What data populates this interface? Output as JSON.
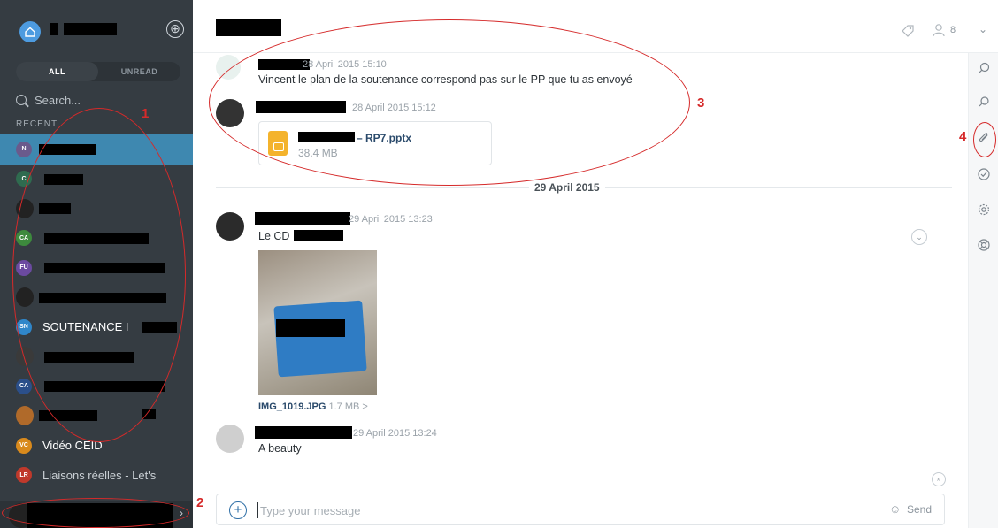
{
  "sidebar": {
    "add_room_symbol": "⊕",
    "filter_tabs": [
      "ALL",
      "UNREAD"
    ],
    "search_placeholder": "Search...",
    "recent_label": "RECENT",
    "rooms": [
      {
        "initials": "N",
        "label": "",
        "color": "#6a5a8c"
      },
      {
        "initials": "C",
        "label": "",
        "color": "#2f6b4f"
      },
      {
        "initials": "",
        "label": "",
        "color": "#222222"
      },
      {
        "initials": "CA",
        "label": "",
        "color": "#3d8a3d"
      },
      {
        "initials": "FU",
        "label": "",
        "color": "#6b4aa0"
      },
      {
        "initials": "",
        "label": "",
        "color": "#222222"
      },
      {
        "initials": "SN",
        "label": "SOUTENANCE I",
        "color": "#2f86c9"
      },
      {
        "initials": "",
        "label": "",
        "color": "#222222"
      },
      {
        "initials": "CA",
        "label": "",
        "color": "#2b4f8a"
      },
      {
        "initials": "",
        "label": "",
        "color": "#b06a2a"
      },
      {
        "initials": "VC",
        "label": "Vidéo CEID",
        "color": "#d98a1c"
      },
      {
        "initials": "LR",
        "label": "Liaisons réelles - Let's",
        "color": "#c0392b"
      }
    ],
    "me_chevron": "›"
  },
  "topbar": {
    "tag_icon": "tag-icon",
    "people_count": "8",
    "chevron": "⌄"
  },
  "messages": [
    {
      "time": "28 April 2015 15:10",
      "text": "Vincent le plan de la soutenance correspond pas sur le PP que tu as envoyé"
    },
    {
      "time": "28 April 2015 15:12",
      "file_name": "– RP7.pptx",
      "file_size": "38.4 MB"
    },
    {
      "time": "29 April 2015 13:23",
      "text": "Le CD",
      "image_name": "IMG_1019.JPG",
      "image_size": "1.7 MB >"
    },
    {
      "time": "29 April 2015 13:24",
      "text": "A beauty"
    }
  ],
  "day_separator": "29 April 2015",
  "composer": {
    "placeholder": "Type your message",
    "send_label": "Send"
  },
  "annotations": [
    "1",
    "2",
    "3",
    "4"
  ],
  "colors": {
    "sidebar_bg": "#353c42",
    "active_room": "#3e88b0",
    "annotation_red": "#d52a2a",
    "file_accent": "#f4b32c"
  }
}
